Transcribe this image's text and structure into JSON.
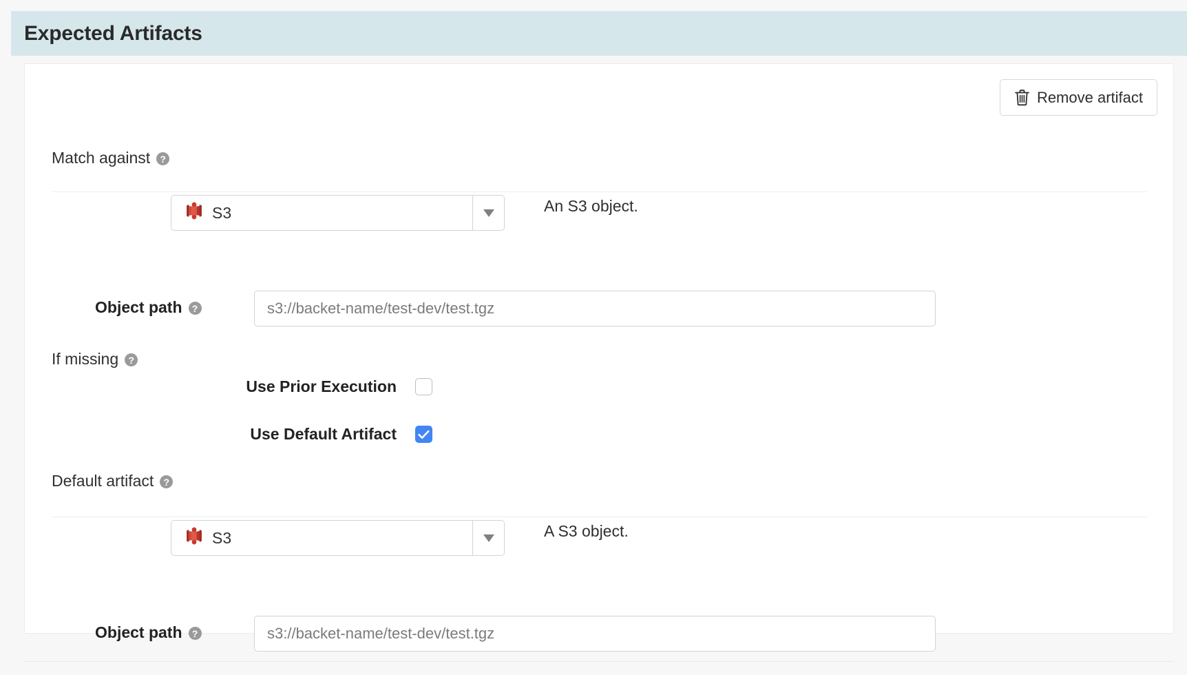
{
  "section": {
    "header_title": "Expected Artifacts",
    "remove_artifact_label": "Remove artifact",
    "remove_artifact_icon": "trash-icon"
  },
  "match_against": {
    "label": "Match against",
    "help_icon": "help-circle-icon",
    "selected_value": "S3",
    "value_icon": "aws-s3-icon",
    "dropdown_icon": "caret-down-icon",
    "description": "An S3 object."
  },
  "object_path_primary": {
    "label": "Object path",
    "help_icon": "help-circle-icon",
    "value": "s3://backet-name/test-dev/test.tgz",
    "placeholder": "s3://backet-name/test-dev/test.tgz"
  },
  "if_missing": {
    "label": "If missing",
    "help_icon": "help-circle-icon",
    "options": [
      {
        "label": "Use Prior Execution",
        "checked": false
      },
      {
        "label": "Use Default Artifact",
        "checked": true
      }
    ]
  },
  "default_artifact": {
    "label": "Default artifact",
    "help_icon": "help-circle-icon",
    "selected_value": "S3",
    "value_icon": "aws-s3-icon",
    "dropdown_icon": "caret-down-icon",
    "description": "A S3 object."
  },
  "object_path_default": {
    "label": "Object path",
    "help_icon": "help-circle-icon",
    "value": "s3://backet-name/test-dev/test.tgz",
    "placeholder": "s3://backet-name/test-dev/test.tgz"
  },
  "colors": {
    "header_background": "#d6e7ec",
    "page_background": "#f7f7f7",
    "card_background": "#ffffff",
    "checkbox_checked": "#4285f4",
    "s3_icon": "#c9392b",
    "help_icon": "#9a9a9a"
  },
  "help_glyph": "?"
}
